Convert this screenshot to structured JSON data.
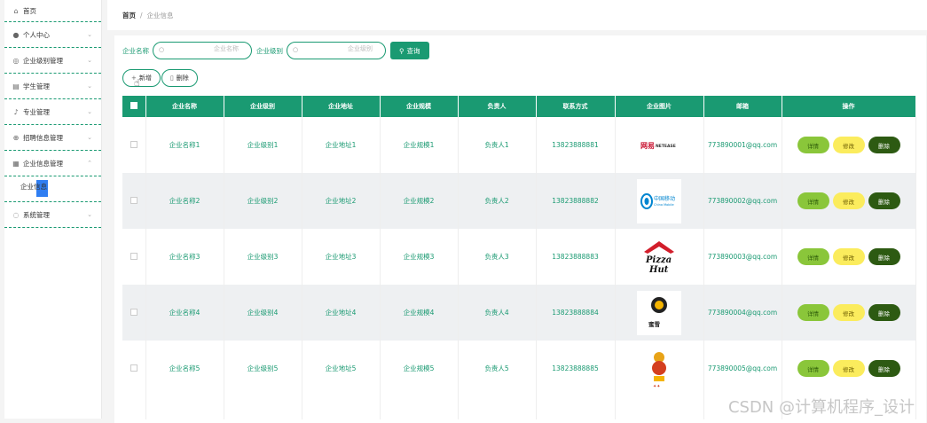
{
  "sidebar": {
    "items": [
      {
        "label": "首页",
        "icon": "home-icon"
      },
      {
        "label": "个人中心",
        "icon": "user-icon"
      },
      {
        "label": "企业级别管理",
        "icon": "level-icon"
      },
      {
        "label": "学生管理",
        "icon": "student-icon"
      },
      {
        "label": "专业管理",
        "icon": "major-icon"
      },
      {
        "label": "招聘信息管理",
        "icon": "recruit-icon"
      },
      {
        "label": "企业信息管理",
        "icon": "company-icon"
      },
      {
        "label": "系统管理",
        "icon": "system-icon"
      }
    ],
    "submenu_label": "企业信息"
  },
  "breadcrumb": {
    "home": "首页",
    "separator": "/",
    "current": "企业信息"
  },
  "search": {
    "name_label": "企业名称",
    "name_placeholder": "企业名称",
    "level_label": "企业级别",
    "level_placeholder": "企业级别",
    "query_label": "查询"
  },
  "actions": {
    "add_label": "新增",
    "delete_label": "删除"
  },
  "table": {
    "headers": [
      "企业名称",
      "企业级别",
      "企业地址",
      "企业规模",
      "负责人",
      "联系方式",
      "企业图片",
      "邮箱",
      "操作"
    ],
    "rows": [
      {
        "name": "企业名称1",
        "level": "企业级别1",
        "address": "企业地址1",
        "scale": "企业规模1",
        "owner": "负责人1",
        "phone": "13823888881",
        "logo": "netease-logo",
        "email": "773890001@qq.com"
      },
      {
        "name": "企业名称2",
        "level": "企业级别2",
        "address": "企业地址2",
        "scale": "企业规模2",
        "owner": "负责人2",
        "phone": "13823888882",
        "logo": "china-mobile-logo",
        "email": "773890002@qq.com"
      },
      {
        "name": "企业名称3",
        "level": "企业级别3",
        "address": "企业地址3",
        "scale": "企业规模3",
        "owner": "负责人3",
        "phone": "13823888883",
        "logo": "pizza-hut-logo",
        "email": "773890003@qq.com"
      },
      {
        "name": "企业名称4",
        "level": "企业级别4",
        "address": "企业地址4",
        "scale": "企业规模4",
        "owner": "负责人4",
        "phone": "13823888884",
        "logo": "mixue-logo",
        "email": "773890004@qq.com"
      },
      {
        "name": "企业名称5",
        "level": "企业级别5",
        "address": "企业地址5",
        "scale": "企业规模5",
        "owner": "负责人5",
        "phone": "13823888885",
        "logo": "mascot-logo",
        "email": "773890005@qq.com"
      }
    ],
    "op_detail": "详情",
    "op_edit": "修改",
    "op_delete": "删除"
  },
  "logos": {
    "netease_text": "网易 NETEASE",
    "china_mobile_text": "中国移动",
    "pizza_hut_text": "Pizza Hut",
    "mixue_text": "蜜雪冰城"
  },
  "watermark": "CSDN @计算机程序_设计",
  "colors": {
    "primary": "#1a9a72",
    "detail": "#8ac63a",
    "edit": "#fbec5d",
    "delete": "#2d5a12"
  }
}
